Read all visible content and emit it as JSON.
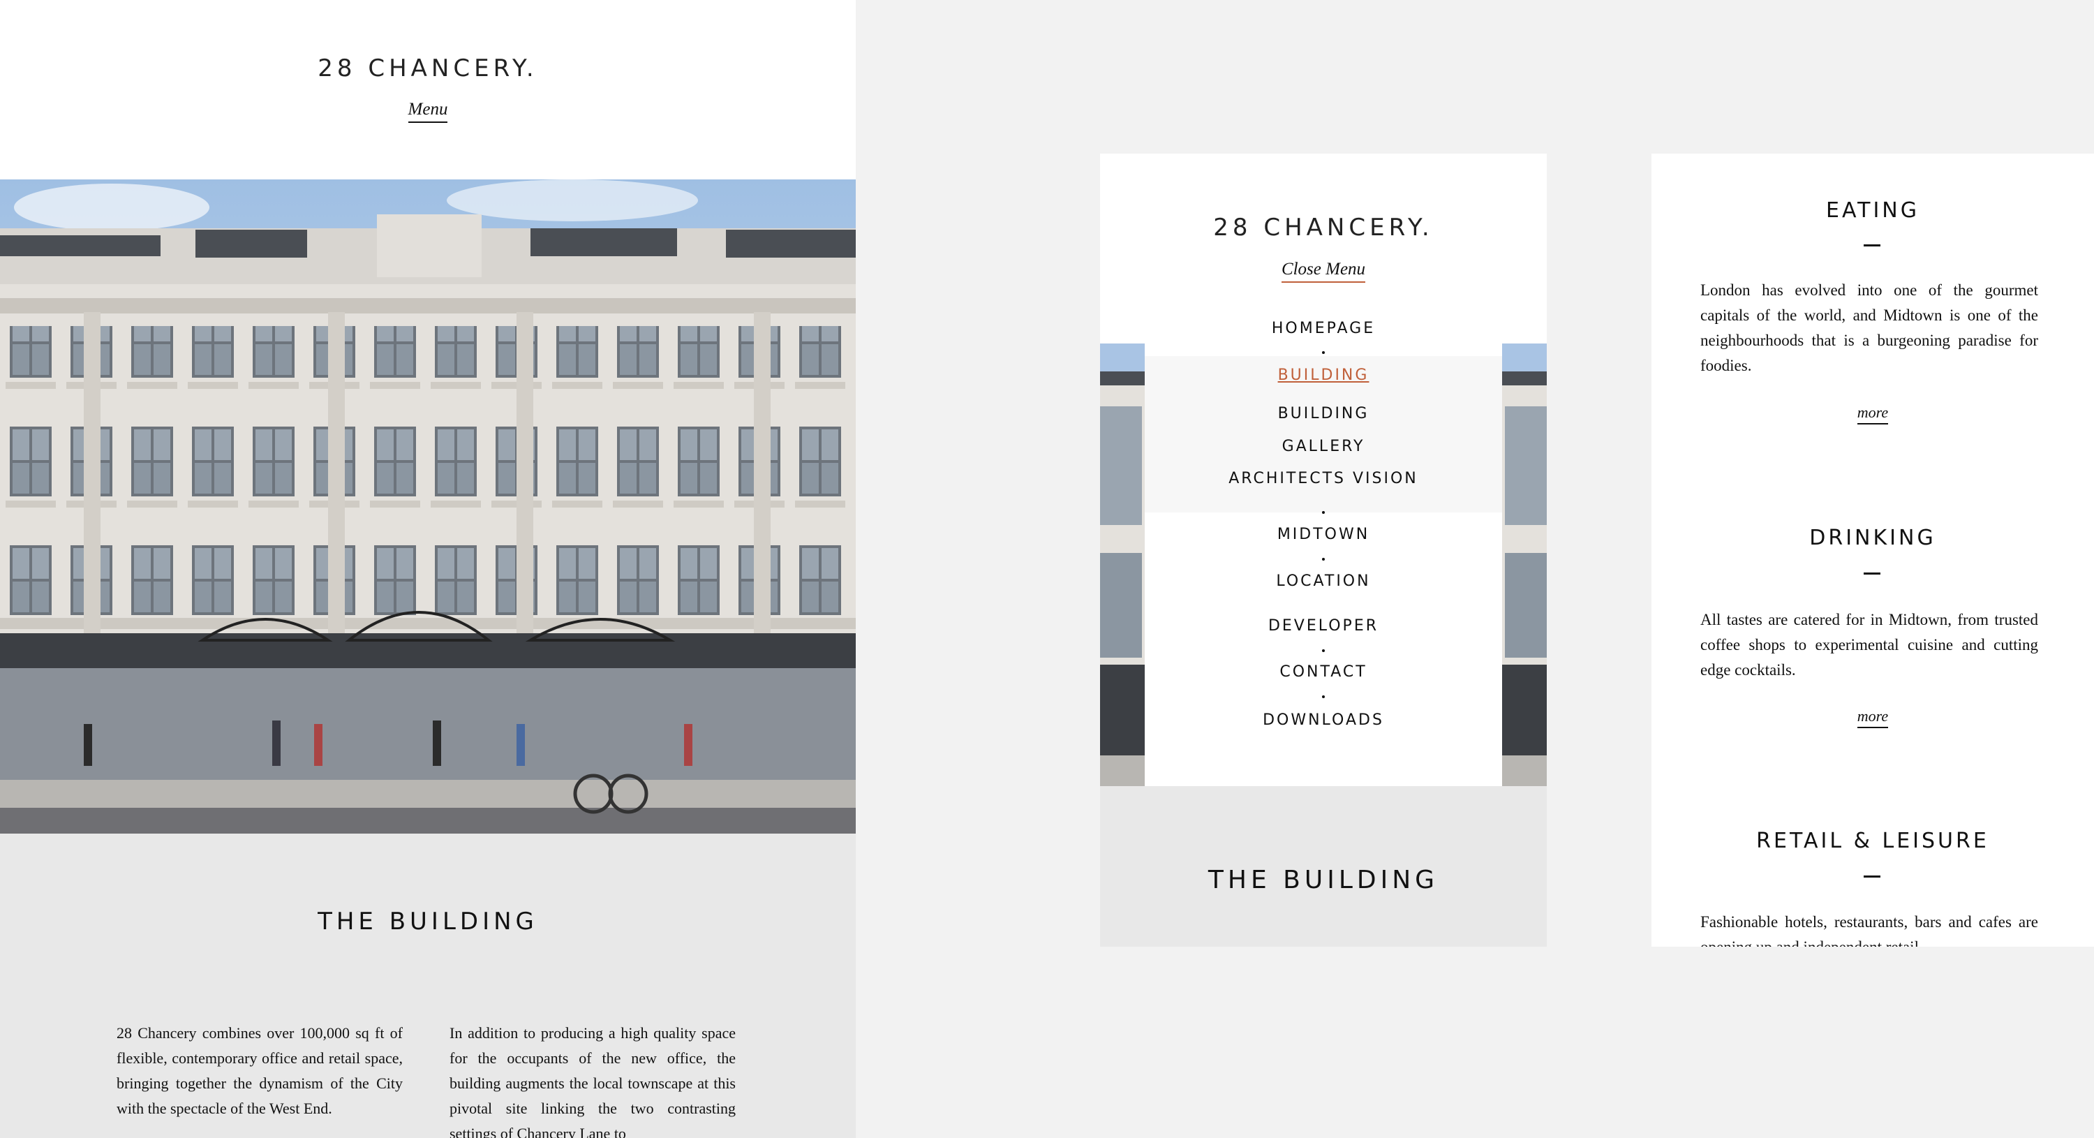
{
  "brand": {
    "logo": "28 CHANCERY."
  },
  "home": {
    "menu_label": "Menu",
    "section_title": "THE BUILDING",
    "column_1": "28 Chancery combines over 100,000 sq ft of flexible, contemporary office and retail space, bringing together the dynamism of the City with the spectacle of the West End.",
    "column_2": "In addition to producing a high quality space for the occupants of the new office, the building augments the local townscape at this pivotal site linking the two contrasting settings of Chancery Lane to"
  },
  "menu": {
    "close_label": "Close Menu",
    "section_title": "THE BUILDING",
    "items": {
      "homepage": "HOMEPAGE",
      "building_active": "BUILDING",
      "building": "BUILDING",
      "gallery": "GALLERY",
      "architects_vision": "ARCHITECTS VISION",
      "midtown": "MIDTOWN",
      "location": "LOCATION",
      "developer": "DEVELOPER",
      "contact": "CONTACT",
      "downloads": "DOWNLOADS"
    },
    "active_color": "#c0603a"
  },
  "lifestyle": {
    "more_label": "more",
    "eating": {
      "title": "EATING",
      "text": "London has evolved into one of the gourmet capitals of the world, and Midtown is one of the neighbourhoods that is a burgeoning paradise for foodies."
    },
    "drinking": {
      "title": "DRINKING",
      "text": "All tastes are catered for in Midtown, from trusted coffee shops to experimental cuisine and cutting edge cocktails."
    },
    "retail": {
      "title": "RETAIL & LEISURE",
      "text": "Fashionable hotels, restaurants, bars and cafes are opening up and independent retail"
    }
  }
}
